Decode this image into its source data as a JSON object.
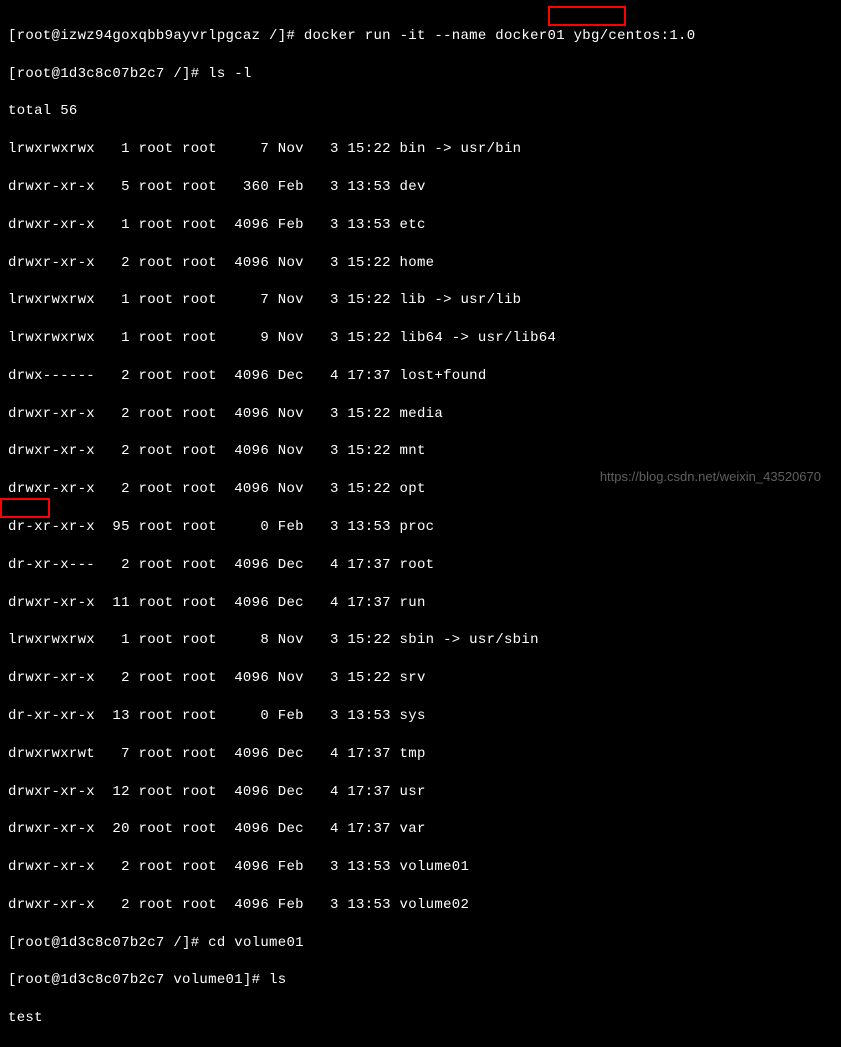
{
  "prompts": {
    "host1": "[root@izwz94goxqbb9ayvrlpgcaz /]# ",
    "container1": "[root@1d3c8c07b2c7 /]# ",
    "container2": "[root@1d3c8c07b2c7 volume01]# "
  },
  "commands": {
    "docker_run": "docker run -it --name docker01 ybg/centos:1.0",
    "ls_l": "ls -l",
    "cd_volume": "cd volume01",
    "ls": "ls"
  },
  "output": {
    "total": "total 56",
    "rows": [
      "lrwxrwxrwx   1 root root     7 Nov   3 15:22 bin -> usr/bin",
      "drwxr-xr-x   5 root root   360 Feb   3 13:53 dev",
      "drwxr-xr-x   1 root root  4096 Feb   3 13:53 etc",
      "drwxr-xr-x   2 root root  4096 Nov   3 15:22 home",
      "lrwxrwxrwx   1 root root     7 Nov   3 15:22 lib -> usr/lib",
      "lrwxrwxrwx   1 root root     9 Nov   3 15:22 lib64 -> usr/lib64",
      "drwx------   2 root root  4096 Dec   4 17:37 lost+found",
      "drwxr-xr-x   2 root root  4096 Nov   3 15:22 media",
      "drwxr-xr-x   2 root root  4096 Nov   3 15:22 mnt",
      "drwxr-xr-x   2 root root  4096 Nov   3 15:22 opt",
      "dr-xr-xr-x  95 root root     0 Feb   3 13:53 proc",
      "dr-xr-x---   2 root root  4096 Dec   4 17:37 root",
      "drwxr-xr-x  11 root root  4096 Dec   4 17:37 run",
      "lrwxrwxrwx   1 root root     8 Nov   3 15:22 sbin -> usr/sbin",
      "drwxr-xr-x   2 root root  4096 Nov   3 15:22 srv",
      "dr-xr-xr-x  13 root root     0 Feb   3 13:53 sys",
      "drwxrwxrwt   7 root root  4096 Dec   4 17:37 tmp",
      "drwxr-xr-x  12 root root  4096 Dec   4 17:37 usr",
      "drwxr-xr-x  20 root root  4096 Dec   4 17:37 var",
      "drwxr-xr-x   2 root root  4096 Feb   3 13:53 volume01",
      "drwxr-xr-x   2 root root  4096 Feb   3 13:53 volume02"
    ],
    "test": "test"
  },
  "watermark": "https://blog.csdn.net/weixin_43520670"
}
